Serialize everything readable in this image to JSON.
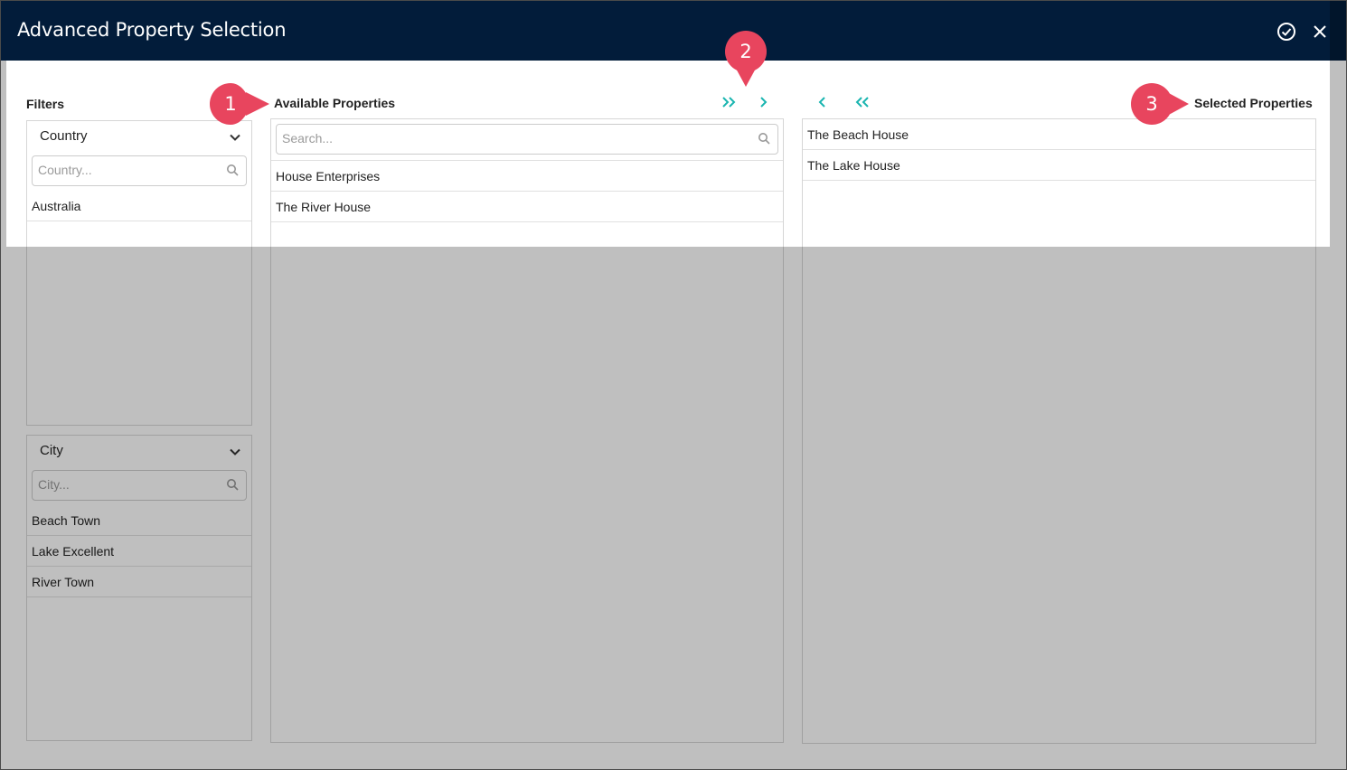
{
  "dialog": {
    "title": "Advanced Property Selection"
  },
  "header": {
    "confirm_icon": "check-circle-icon",
    "close_icon": "close-icon"
  },
  "filters": {
    "label": "Filters",
    "country": {
      "heading": "Country",
      "placeholder": "Country...",
      "items": [
        "Australia"
      ]
    },
    "city": {
      "heading": "City",
      "placeholder": "City...",
      "items": [
        "Beach Town",
        "Lake Excellent",
        "River Town"
      ]
    }
  },
  "available": {
    "label": "Available Properties",
    "search_placeholder": "Search...",
    "items": [
      "House Enterprises",
      "The River House"
    ]
  },
  "selected": {
    "label": "Selected Properties",
    "items": [
      "The Beach House",
      "The Lake House"
    ]
  },
  "transfer": {
    "add_all_icon": "double-chevron-right-icon",
    "add_icon": "chevron-right-icon",
    "remove_icon": "chevron-left-icon",
    "remove_all_icon": "double-chevron-left-icon"
  },
  "callouts": [
    "1",
    "2",
    "3"
  ],
  "colors": {
    "header_bg": "#021c3a",
    "accent": "#1ab5b0",
    "callout": "#e8455e"
  }
}
